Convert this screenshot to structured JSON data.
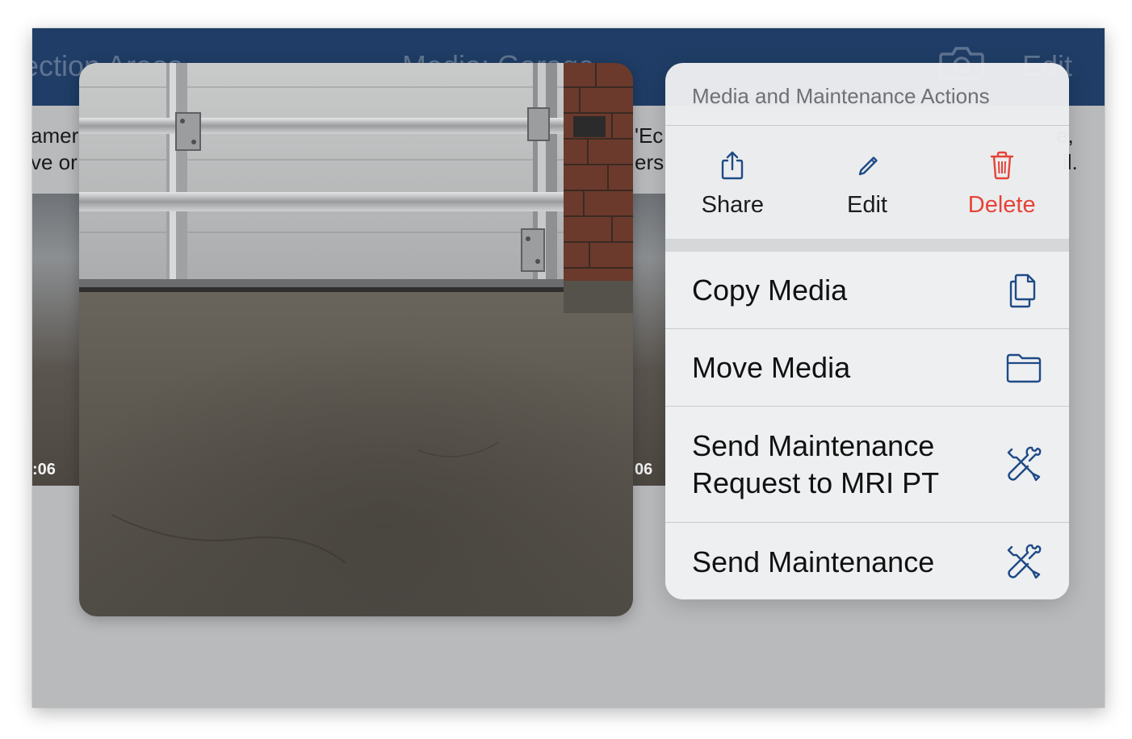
{
  "navbar": {
    "back_label": "ection Areas",
    "title": "Media: Garage",
    "edit_label": "Edit",
    "camera_icon": "camera-icon"
  },
  "background": {
    "left_text_line1": "amer",
    "left_text_line2": "ve or",
    "right_text_line1": "'Ec",
    "right_text_line2": "ers",
    "far_right_line1": "e,",
    "far_right_line2": "il.",
    "left_duration": ":06",
    "right_duration": "06"
  },
  "menu": {
    "header": "Media and Maintenance Actions",
    "quick_actions": [
      {
        "label": "Share",
        "icon": "share-icon"
      },
      {
        "label": "Edit",
        "icon": "pencil-icon"
      },
      {
        "label": "Delete",
        "icon": "trash-icon"
      }
    ],
    "items": [
      {
        "label": "Copy Media",
        "icon": "copy-icon"
      },
      {
        "label": "Move Media",
        "icon": "folder-icon"
      },
      {
        "label": "Send Maintenance Request to MRI PT",
        "icon": "tools-icon"
      },
      {
        "label": "Send Maintenance",
        "icon": "tools-icon"
      }
    ]
  },
  "colors": {
    "navbar": "#1f3d66",
    "danger": "#e54338",
    "icon_blue": "#1e4a86"
  }
}
